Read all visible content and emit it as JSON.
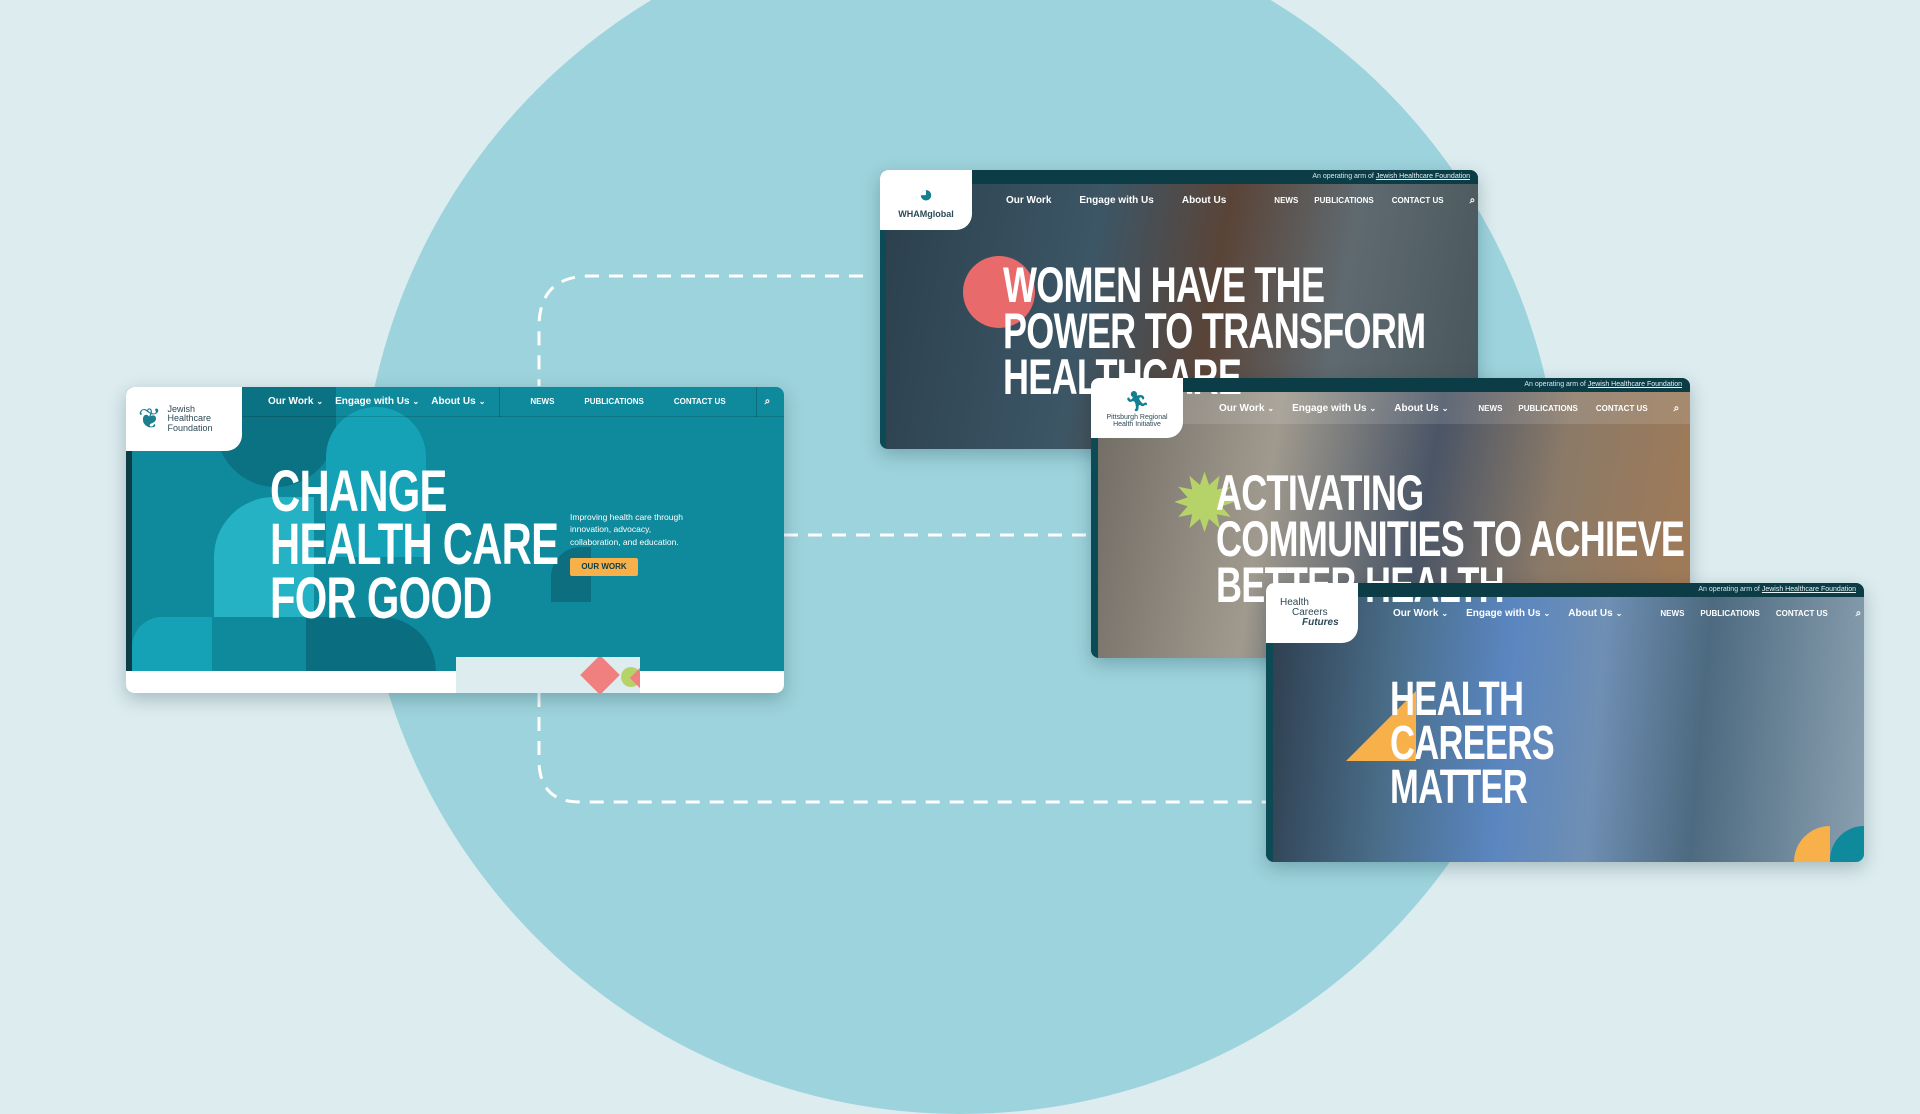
{
  "colors": {
    "background": "#dcecef",
    "circle": "#9dd3dc",
    "jhf_teal": "#0e8a9c",
    "dark_teal": "#0c3d47",
    "accent_orange": "#f7b04a",
    "accent_coral": "#e86a6a",
    "accent_green": "#b6d36a"
  },
  "jhf": {
    "logo": "Jewish Healthcare Foundation",
    "nav": [
      "Our Work",
      "Engage with Us",
      "About Us",
      "NEWS",
      "PUBLICATIONS",
      "CONTACT US"
    ],
    "search_icon": "search-icon",
    "headline": [
      "CHANGE",
      "HEALTH CARE",
      "FOR GOOD"
    ],
    "tagline": "Improving health care through innovation, advocacy, collaboration, and education.",
    "cta": "OUR WORK"
  },
  "wham": {
    "operating_arm": "An operating arm of",
    "operating_link": "Jewish Healthcare Foundation",
    "logo": "WHAMglobal",
    "nav": [
      "Our Work",
      "Engage with Us",
      "About Us",
      "NEWS",
      "PUBLICATIONS",
      "CONTACT US"
    ],
    "headline": [
      "WOMEN HAVE THE",
      "POWER TO TRANSFORM",
      "HEALTHCARE"
    ]
  },
  "prhi": {
    "operating_arm": "An operating arm of",
    "operating_link": "Jewish Healthcare Foundation",
    "logo": "Pittsburgh Regional Health Initiative",
    "nav": [
      "Our Work",
      "Engage with Us",
      "About Us",
      "NEWS",
      "PUBLICATIONS",
      "CONTACT US"
    ],
    "headline": [
      "ACTIVATING",
      "COMMUNITIES TO ACHIEVE",
      "BETTER HEALTH"
    ]
  },
  "hcf": {
    "operating_arm": "An operating arm of",
    "operating_link": "Jewish Healthcare Foundation",
    "logo": [
      "Health",
      "Careers",
      "Futures"
    ],
    "nav": [
      "Our Work",
      "Engage with Us",
      "About Us",
      "NEWS",
      "PUBLICATIONS",
      "CONTACT US"
    ],
    "headline": [
      "HEALTH",
      "CAREERS",
      "MATTER"
    ]
  }
}
